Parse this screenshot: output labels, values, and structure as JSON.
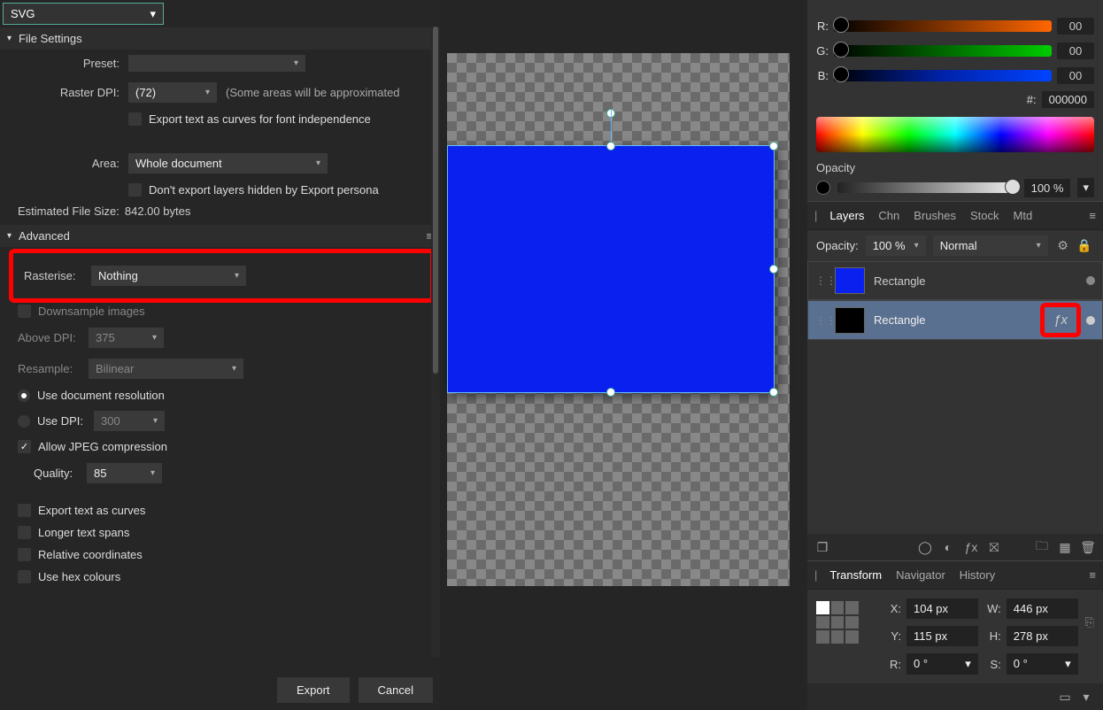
{
  "format": "SVG",
  "file_settings": {
    "title": "File Settings",
    "preset_label": "Preset:",
    "preset_value": "",
    "raster_dpi_label": "Raster DPI:",
    "raster_dpi_value": "(72)",
    "raster_dpi_note": "(Some areas will be approximated",
    "export_curves": "Export text as curves for font independence",
    "area_label": "Area:",
    "area_value": "Whole document",
    "hidden_layers": "Don't export layers hidden by Export persona",
    "est_label": "Estimated File Size:",
    "est_value": "842.00 bytes"
  },
  "advanced": {
    "title": "Advanced",
    "rasterise_label": "Rasterise:",
    "rasterise_value": "Nothing",
    "downsample": "Downsample images",
    "above_dpi_label": "Above DPI:",
    "above_dpi_value": "375",
    "resample_label": "Resample:",
    "resample_value": "Bilinear",
    "use_doc_res": "Use document resolution",
    "use_dpi": "Use DPI:",
    "use_dpi_value": "300",
    "allow_jpeg": "Allow JPEG compression",
    "quality_label": "Quality:",
    "quality_value": "85",
    "export_curves": "Export text as curves",
    "longer_spans": "Longer text spans",
    "relative_coords": "Relative coordinates",
    "use_hex": "Use hex colours"
  },
  "buttons": {
    "export": "Export",
    "cancel": "Cancel"
  },
  "color": {
    "r_label": "R:",
    "r_val": "00",
    "g_label": "G:",
    "g_val": "00",
    "b_label": "B:",
    "b_val": "00",
    "hex_prefix": "#:",
    "hex_val": "000000",
    "opacity_label": "Opacity",
    "opacity_val": "100 %"
  },
  "layers_panel": {
    "tabs": [
      "Layers",
      "Chn",
      "Brushes",
      "Stock",
      "Mtd"
    ],
    "opacity_label": "Opacity:",
    "opacity_val": "100 %",
    "blend": "Normal",
    "items": [
      {
        "name": "Rectangle",
        "color": "#0a20ee",
        "sel": false,
        "fx": false
      },
      {
        "name": "Rectangle",
        "color": "#000",
        "sel": true,
        "fx": true
      }
    ]
  },
  "transform": {
    "tabs": [
      "Transform",
      "Navigator",
      "History"
    ],
    "x_label": "X:",
    "x_val": "104 px",
    "y_label": "Y:",
    "y_val": "115 px",
    "w_label": "W:",
    "w_val": "446 px",
    "h_label": "H:",
    "h_val": "278 px",
    "r_label": "R:",
    "r_val": "0 °",
    "s_label": "S:",
    "s_val": "0 °"
  }
}
